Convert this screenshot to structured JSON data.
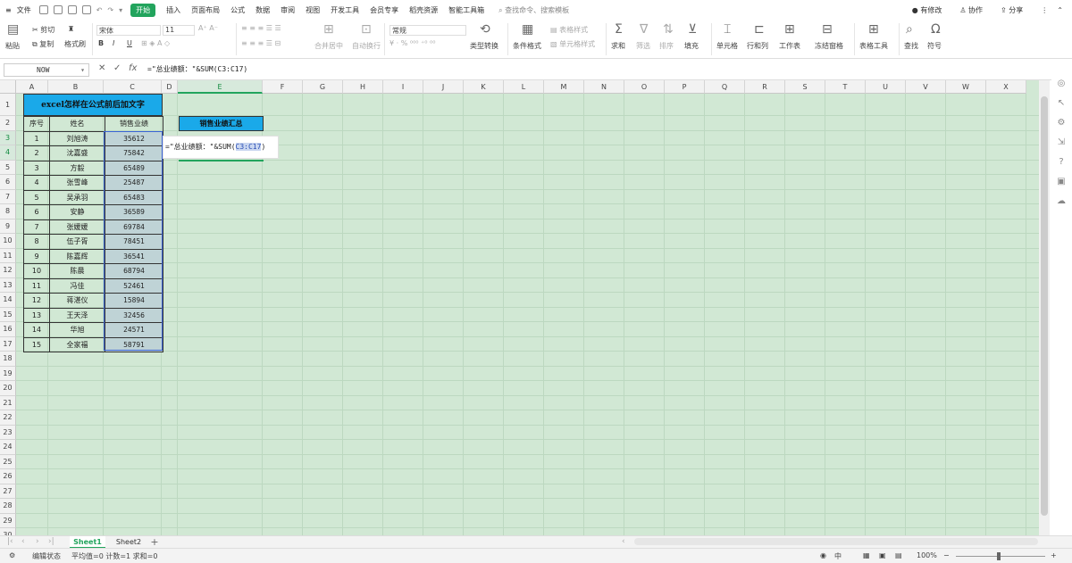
{
  "menubar": {
    "file": "文件",
    "tabs": [
      "开始",
      "插入",
      "页面布局",
      "公式",
      "数据",
      "审阅",
      "视图",
      "开发工具",
      "会员专享",
      "稻壳资源",
      "智能工具箱"
    ],
    "active_tab": "开始",
    "search": "查找命令、搜索模板",
    "modify": "有修改",
    "collab": "协作",
    "share": "分享"
  },
  "ribbon": {
    "paste": "粘贴",
    "cut": "剪切",
    "copy": "复制",
    "format_painter": "格式刷",
    "font_name": "宋体",
    "font_size": "11",
    "bold": "B",
    "italic": "I",
    "underline": "U",
    "merge": "合并居中",
    "wrap": "自动换行",
    "number_format": "常规",
    "type_convert": "类型转换",
    "cond_format": "条件格式",
    "table_style": "表格样式",
    "cell_style": "单元格样式",
    "sum": "求和",
    "filter": "筛选",
    "sort": "排序",
    "fill": "填充",
    "cell": "单元格",
    "rowcol": "行和列",
    "sheet": "工作表",
    "freeze": "冻结窗格",
    "table_tools": "表格工具",
    "find": "查找",
    "symbol": "符号"
  },
  "formula_bar": {
    "name_box": "NOW",
    "fx": "fx",
    "formula": "=\"总业绩额：\"&SUM(C3:C17)"
  },
  "grid": {
    "columns": [
      "A",
      "B",
      "C",
      "D",
      "E",
      "F",
      "G",
      "H",
      "I",
      "J",
      "K",
      "L",
      "M",
      "N",
      "O",
      "P",
      "Q",
      "R",
      "S",
      "T",
      "U",
      "V",
      "W",
      "X"
    ],
    "rows": [
      "1",
      "2",
      "3",
      "4",
      "5",
      "6",
      "7",
      "8",
      "9",
      "10",
      "11",
      "12",
      "13",
      "14",
      "15",
      "16",
      "17",
      "18",
      "19",
      "20",
      "21",
      "22",
      "23",
      "24",
      "25",
      "26",
      "27",
      "28",
      "29",
      "30"
    ],
    "title": "excel怎样在公式前后加文字",
    "headers": [
      "序号",
      "姓名",
      "销售业绩"
    ],
    "records": [
      [
        "1",
        "刘旭涛",
        "35612"
      ],
      [
        "2",
        "沈嘉盛",
        "75842"
      ],
      [
        "3",
        "方毅",
        "65489"
      ],
      [
        "4",
        "张雪峰",
        "25487"
      ],
      [
        "5",
        "吴承羽",
        "65483"
      ],
      [
        "6",
        "安静",
        "36589"
      ],
      [
        "7",
        "张媛媛",
        "69784"
      ],
      [
        "8",
        "伍子胥",
        "78451"
      ],
      [
        "9",
        "陈嘉辉",
        "36541"
      ],
      [
        "10",
        "陈晨",
        "68794"
      ],
      [
        "11",
        "冯佳",
        "52461"
      ],
      [
        "12",
        "蒋湛仪",
        "15894"
      ],
      [
        "13",
        "王天泽",
        "32456"
      ],
      [
        "14",
        "华旭",
        "24571"
      ],
      [
        "15",
        "全家福",
        "58791"
      ]
    ],
    "summary_header": "销售业绩汇总",
    "edit_text_before": "=\"总业绩额：\"&SUM(",
    "edit_ref": "C3:C17",
    "edit_text_after": ")"
  },
  "sheets": [
    "Sheet1",
    "Sheet2"
  ],
  "status": {
    "mode": "编辑状态",
    "stats": "平均值=0  计数=1  求和=0",
    "zoom": "100%"
  },
  "colors": {
    "accent": "#22a45d",
    "header_fill": "#1aa9e9",
    "grid_bg": "#d1e8d4"
  }
}
